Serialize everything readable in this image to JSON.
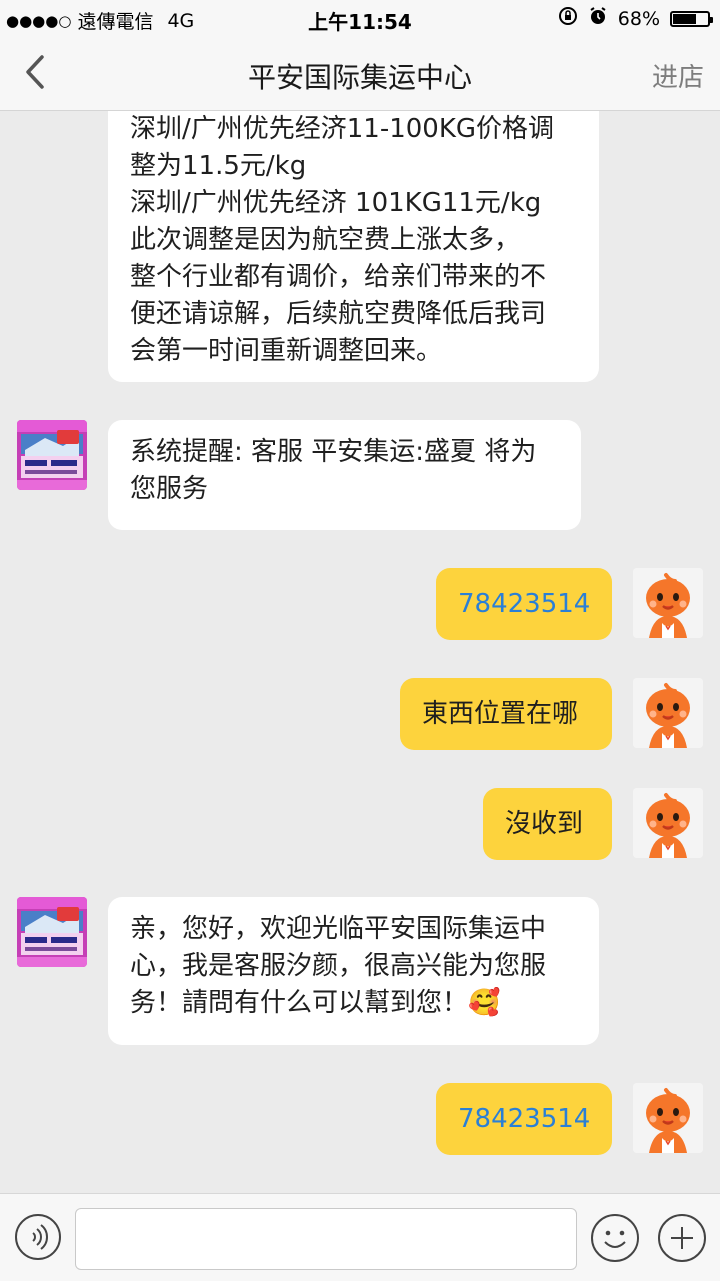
{
  "status": {
    "signal": "●●●●○",
    "carrier": "遠傳電信",
    "network": "4G",
    "time": "上午11:54",
    "battery_text": "68%",
    "battery_level": 0.68
  },
  "nav": {
    "back_icon": "chevron-left-icon",
    "title": "平安国际集运中心",
    "store_label": "进店"
  },
  "messages": {
    "m1": {
      "lines": [
        "深圳/广州优先经济11-100KG价格调",
        "整为11.5元/kg",
        "深圳/广州优先经济 101KG11元/kg",
        " 此次调整是因为航空费上涨太多，",
        "整个行业都有调价，给亲们带来的不",
        "便还请谅解，后续航空费降低后我司",
        "会第一时间重新调整回来。"
      ]
    },
    "m2": {
      "lines": [
        "系统提醒: 客服 平安集运:盛夏 将为",
        "您服务"
      ]
    },
    "m3": {
      "text": "78423514"
    },
    "m4": {
      "text": "東西位置在哪"
    },
    "m5": {
      "text": "沒收到"
    },
    "m6": {
      "lines": [
        "亲，您好，欢迎光临平安国际集运中",
        "心，我是客服汐颜，很高兴能为您服",
        "务！請問有什么可以幫到您！🥰"
      ]
    },
    "m7": {
      "text": "78423514"
    }
  },
  "input": {
    "placeholder": ""
  },
  "colors": {
    "background": "#ebebeb",
    "bubble_out": "#fdd33d",
    "bubble_in": "#ffffff",
    "number_link": "#2a7fd6",
    "avatar_orange": "#f5762a"
  }
}
